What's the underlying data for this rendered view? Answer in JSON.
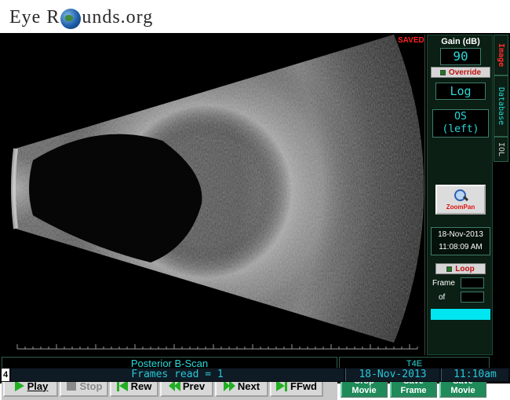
{
  "logo": {
    "text_before": "Eye R",
    "text_after": "unds.org",
    "icon": "globe-icon"
  },
  "scan": {
    "saved_label": "SAVED",
    "title": "Posterior B-Scan",
    "probe": "T4E"
  },
  "panel": {
    "gain_label": "Gain (dB)",
    "gain_value": "90",
    "override_label": "Override",
    "scale_value": "Log",
    "eye_line1": "OS",
    "eye_line2": "(left)",
    "zoom_label": "ZoomPan",
    "date": "18-Nov-2013",
    "time": "11:08:09 AM",
    "loop_label": "Loop",
    "frame_label": "Frame",
    "of_label": "of"
  },
  "tabs": [
    "Image",
    "Database",
    "IOL"
  ],
  "controls": {
    "play": "Play",
    "stop": "Stop",
    "rew": "Rew",
    "prev": "Prev",
    "next": "Next",
    "ffwd": "FFwd"
  },
  "movie_buttons": {
    "crop": "Crop Movie",
    "save_frame": "Save Frame",
    "save_movie": "Save Movie"
  },
  "status": {
    "number": "4",
    "frames_read": "Frames read = 1",
    "date": "18-Nov-2013",
    "time": "11:10am"
  },
  "colors": {
    "accent": "#28d8d8",
    "alert": "#ff2020",
    "button_green": "#1f8a5a"
  }
}
